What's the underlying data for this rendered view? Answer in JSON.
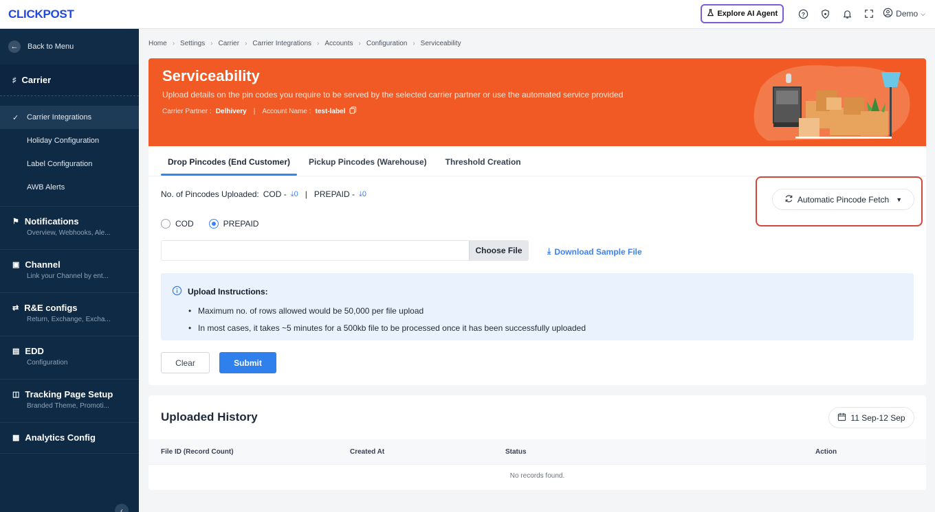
{
  "app": {
    "logo": "CLICKPOST",
    "explore_ai": "Explore AI Agent",
    "user": "Demo"
  },
  "sidebar": {
    "back": "Back to Menu",
    "section": "Carrier",
    "sub_items": [
      {
        "label": "Carrier Integrations",
        "active": true
      },
      {
        "label": "Holiday Configuration"
      },
      {
        "label": "Label Configuration"
      },
      {
        "label": "AWB Alerts"
      }
    ],
    "groups": [
      {
        "title": "Notifications",
        "sub": "Overview, Webhooks, Ale..."
      },
      {
        "title": "Channel",
        "sub": "Link your Channel by ent..."
      },
      {
        "title": "R&E configs",
        "sub": "Return, Exchange, Excha..."
      },
      {
        "title": "EDD",
        "sub": "Configuration"
      },
      {
        "title": "Tracking Page Setup",
        "sub": "Branded Theme, Promoti..."
      },
      {
        "title": "Analytics Config",
        "sub": ""
      }
    ]
  },
  "breadcrumb": [
    "Home",
    "Settings",
    "Carrier",
    "Carrier Integrations",
    "Accounts",
    "Configuration",
    "Serviceability"
  ],
  "banner": {
    "title": "Serviceability",
    "description": "Upload details on the pin codes you require to be served by the selected carrier partner or use the automated service provided",
    "carrier_label": "Carrier Partner :",
    "carrier_value": "Delhivery",
    "account_label": "Account Name :",
    "account_value": "test-label"
  },
  "tabs": [
    "Drop Pincodes (End Customer)",
    "Pickup Pincodes (Warehouse)",
    "Threshold Creation"
  ],
  "upload": {
    "count_label": "No. of Pincodes Uploaded:",
    "cod_label": "COD -",
    "cod_count": "0",
    "prepaid_label": "PREPAID -",
    "prepaid_count": "0",
    "radio_cod": "COD",
    "radio_prepaid": "PREPAID",
    "selected": "PREPAID",
    "choose_file": "Choose File",
    "download_sample": "Download Sample File",
    "auto_fetch": "Automatic Pincode Fetch",
    "instructions_title": "Upload Instructions:",
    "instructions": [
      "Maximum no. of rows allowed would be 50,000 per file upload",
      "In most cases, it takes ~5 minutes for a 500kb file to be processed once it has been successfully uploaded"
    ],
    "clear": "Clear",
    "submit": "Submit"
  },
  "history": {
    "title": "Uploaded History",
    "date_range": "11 Sep-12 Sep",
    "columns": [
      "File ID (Record Count)",
      "Created At",
      "Status",
      "Action"
    ],
    "empty": "No records found."
  },
  "colors": {
    "banner": "#f15a24",
    "sidebar": "#0f2a44",
    "accent": "#2f80ed"
  }
}
